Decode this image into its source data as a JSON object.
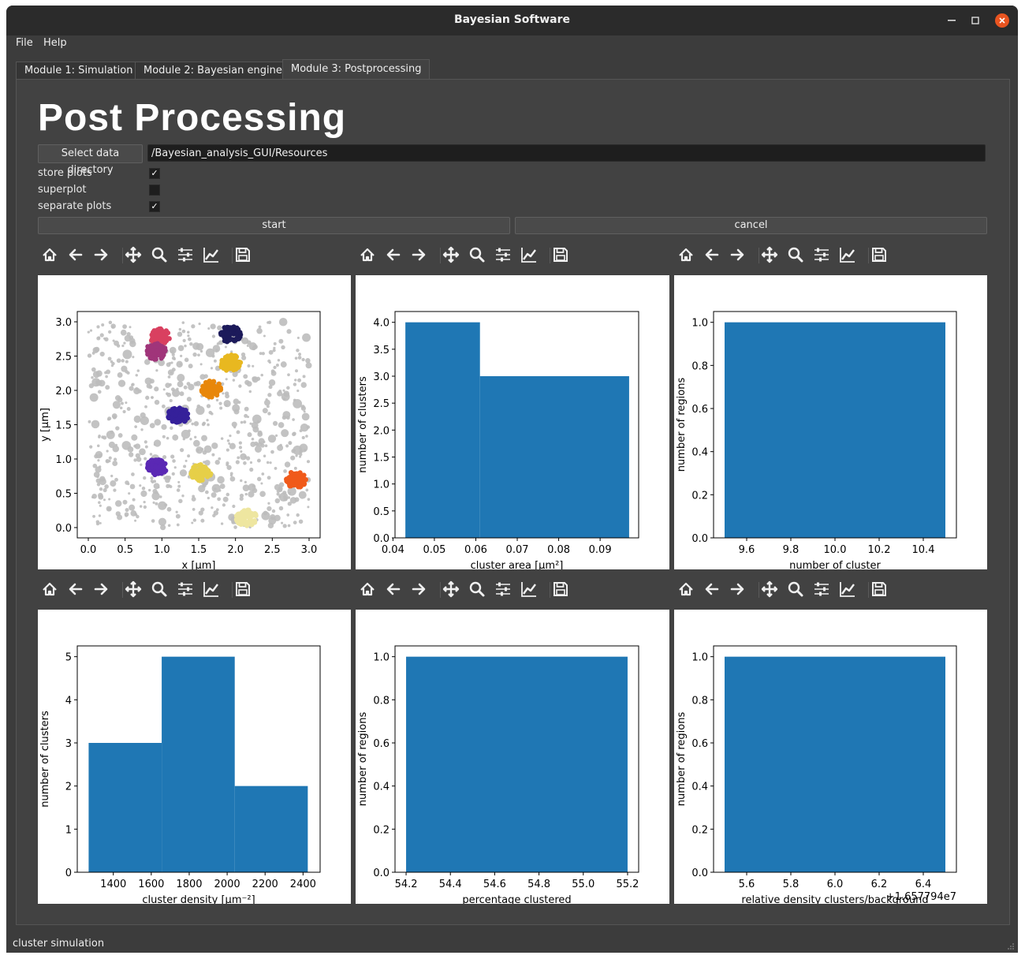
{
  "window": {
    "title": "Bayesian Software"
  },
  "menu": {
    "items": [
      "File",
      "Help"
    ]
  },
  "tabs": [
    "Module 1: Simulation",
    "Module 2: Bayesian engine",
    "Module 3: Postprocessing"
  ],
  "header": {
    "title": "Post Processing"
  },
  "directory": {
    "button": "Select data directory",
    "path": "/Bayesian_analysis_GUI/Resources"
  },
  "options": [
    {
      "label": "store plots",
      "checked": true
    },
    {
      "label": "superplot",
      "checked": false
    },
    {
      "label": "separate plots",
      "checked": true
    }
  ],
  "actions": {
    "start": "start",
    "cancel": "cancel"
  },
  "toolbar_icons": [
    "home-icon",
    "back-arrow-icon",
    "forward-arrow-icon",
    "pan-icon",
    "zoom-icon",
    "configure-subplots-icon",
    "edit-axes-icon",
    "save-icon"
  ],
  "status": "cluster simulation",
  "chart_data": [
    {
      "type": "scatter",
      "xlabel": "x [µm]",
      "ylabel": "y [µm]",
      "xlim": [
        -0.15,
        3.15
      ],
      "ylim": [
        -0.15,
        3.15
      ],
      "xticks": [
        "0.0",
        "0.5",
        "1.0",
        "1.5",
        "2.0",
        "2.5",
        "3.0"
      ],
      "yticks": [
        "0.0",
        "0.5",
        "1.0",
        "1.5",
        "2.0",
        "2.5",
        "3.0"
      ],
      "background_points": {
        "color": "#bdbdbd",
        "count": 700
      },
      "clusters": [
        {
          "x": 0.97,
          "y": 2.78,
          "color": "#d94060"
        },
        {
          "x": 0.92,
          "y": 2.57,
          "color": "#a0357a"
        },
        {
          "x": 1.93,
          "y": 2.82,
          "color": "#1c1a5a"
        },
        {
          "x": 1.93,
          "y": 2.4,
          "color": "#e8b820"
        },
        {
          "x": 1.67,
          "y": 2.02,
          "color": "#e8870a"
        },
        {
          "x": 1.22,
          "y": 1.63,
          "color": "#35209a"
        },
        {
          "x": 0.93,
          "y": 0.88,
          "color": "#5a28b4"
        },
        {
          "x": 1.53,
          "y": 0.8,
          "color": "#e6cf48"
        },
        {
          "x": 2.82,
          "y": 0.7,
          "color": "#f05a1a"
        },
        {
          "x": 2.15,
          "y": 0.14,
          "color": "#eee6a0"
        }
      ]
    },
    {
      "type": "bar",
      "xlabel": "cluster area [µm²]",
      "ylabel": "number of clusters",
      "xlim": [
        0.0405,
        0.0993
      ],
      "ylim": [
        0,
        4.2
      ],
      "xticks": [
        "0.04",
        "0.05",
        "0.06",
        "0.07",
        "0.08",
        "0.09"
      ],
      "yticks": [
        "0.0",
        "0.5",
        "1.0",
        "1.5",
        "2.0",
        "2.5",
        "3.0",
        "3.5",
        "4.0"
      ],
      "bins": [
        {
          "x0": 0.043,
          "x1": 0.061,
          "value": 4
        },
        {
          "x0": 0.061,
          "x1": 0.097,
          "value": 3
        }
      ],
      "color": "#1f77b4"
    },
    {
      "type": "bar",
      "xlabel": "number of cluster",
      "ylabel": "number of regions",
      "xlim": [
        9.45,
        10.55
      ],
      "ylim": [
        0,
        1.05
      ],
      "xticks": [
        "9.6",
        "9.8",
        "10.0",
        "10.2",
        "10.4"
      ],
      "yticks": [
        "0.0",
        "0.2",
        "0.4",
        "0.6",
        "0.8",
        "1.0"
      ],
      "bins": [
        {
          "x0": 9.5,
          "x1": 10.5,
          "value": 1
        }
      ],
      "color": "#1f77b4"
    },
    {
      "type": "bar",
      "xlabel": "cluster density [µm⁻²]",
      "ylabel": "number of clusters",
      "xlim": [
        1210,
        2490
      ],
      "ylim": [
        0,
        5.25
      ],
      "xticks": [
        "1400",
        "1600",
        "1800",
        "2000",
        "2200",
        "2400"
      ],
      "yticks": [
        "0",
        "1",
        "2",
        "3",
        "4",
        "5"
      ],
      "bins": [
        {
          "x0": 1270,
          "x1": 1655,
          "value": 3
        },
        {
          "x0": 1655,
          "x1": 2040,
          "value": 5
        },
        {
          "x0": 2040,
          "x1": 2425,
          "value": 2
        }
      ],
      "color": "#1f77b4"
    },
    {
      "type": "bar",
      "xlabel": "percentage clustered",
      "ylabel": "number of regions",
      "xlim": [
        54.15,
        55.25
      ],
      "ylim": [
        0,
        1.05
      ],
      "xticks": [
        "54.2",
        "54.4",
        "54.6",
        "54.8",
        "55.0",
        "55.2"
      ],
      "yticks": [
        "0.0",
        "0.2",
        "0.4",
        "0.6",
        "0.8",
        "1.0"
      ],
      "bins": [
        {
          "x0": 54.2,
          "x1": 55.2,
          "value": 1
        }
      ],
      "color": "#1f77b4"
    },
    {
      "type": "bar",
      "xlabel": "relative density clusters/background",
      "ylabel": "number of regions",
      "offset_text": "+1.657794e7",
      "xlim": [
        5.45,
        6.55
      ],
      "ylim": [
        0,
        1.05
      ],
      "xticks": [
        "5.6",
        "5.8",
        "6.0",
        "6.2",
        "6.4"
      ],
      "yticks": [
        "0.0",
        "0.2",
        "0.4",
        "0.6",
        "0.8",
        "1.0"
      ],
      "bins": [
        {
          "x0": 5.5,
          "x1": 6.5,
          "value": 1
        }
      ],
      "color": "#1f77b4"
    }
  ]
}
